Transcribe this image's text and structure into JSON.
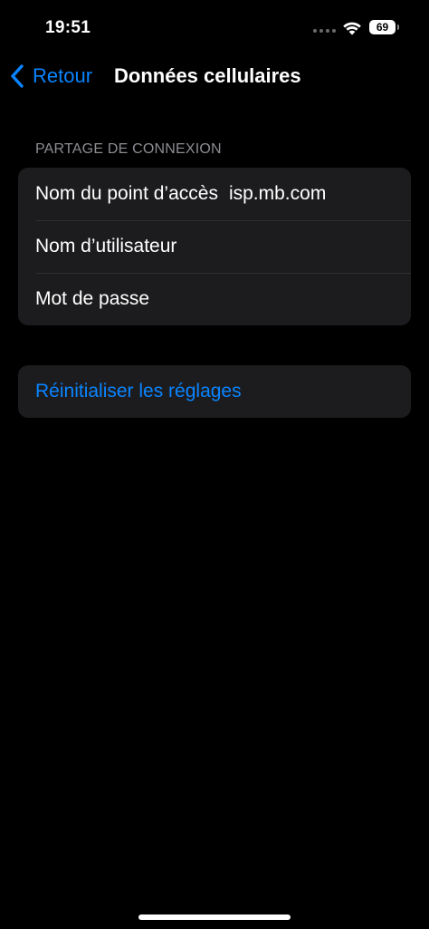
{
  "status_bar": {
    "time": "19:51",
    "battery": "69",
    "icons": [
      "signal-dots-icon",
      "wifi-icon",
      "battery-icon"
    ]
  },
  "nav": {
    "back_label": "Retour",
    "back_icon": "chevron-left-icon",
    "title": "Données cellulaires"
  },
  "sections": {
    "tethering": {
      "header": "PARTAGE DE CONNEXION",
      "rows": [
        {
          "label": "Nom du point d’accès",
          "value": "isp.mb.com"
        },
        {
          "label": "Nom d’utilisateur",
          "value": ""
        },
        {
          "label": "Mot de passe",
          "value": ""
        }
      ]
    },
    "reset": {
      "label": "Réinitialiser les réglages"
    }
  },
  "colors": {
    "background": "#000000",
    "cell_background": "#1c1c1e",
    "accent": "#0a84ff",
    "secondary_text": "#8d8d93"
  }
}
